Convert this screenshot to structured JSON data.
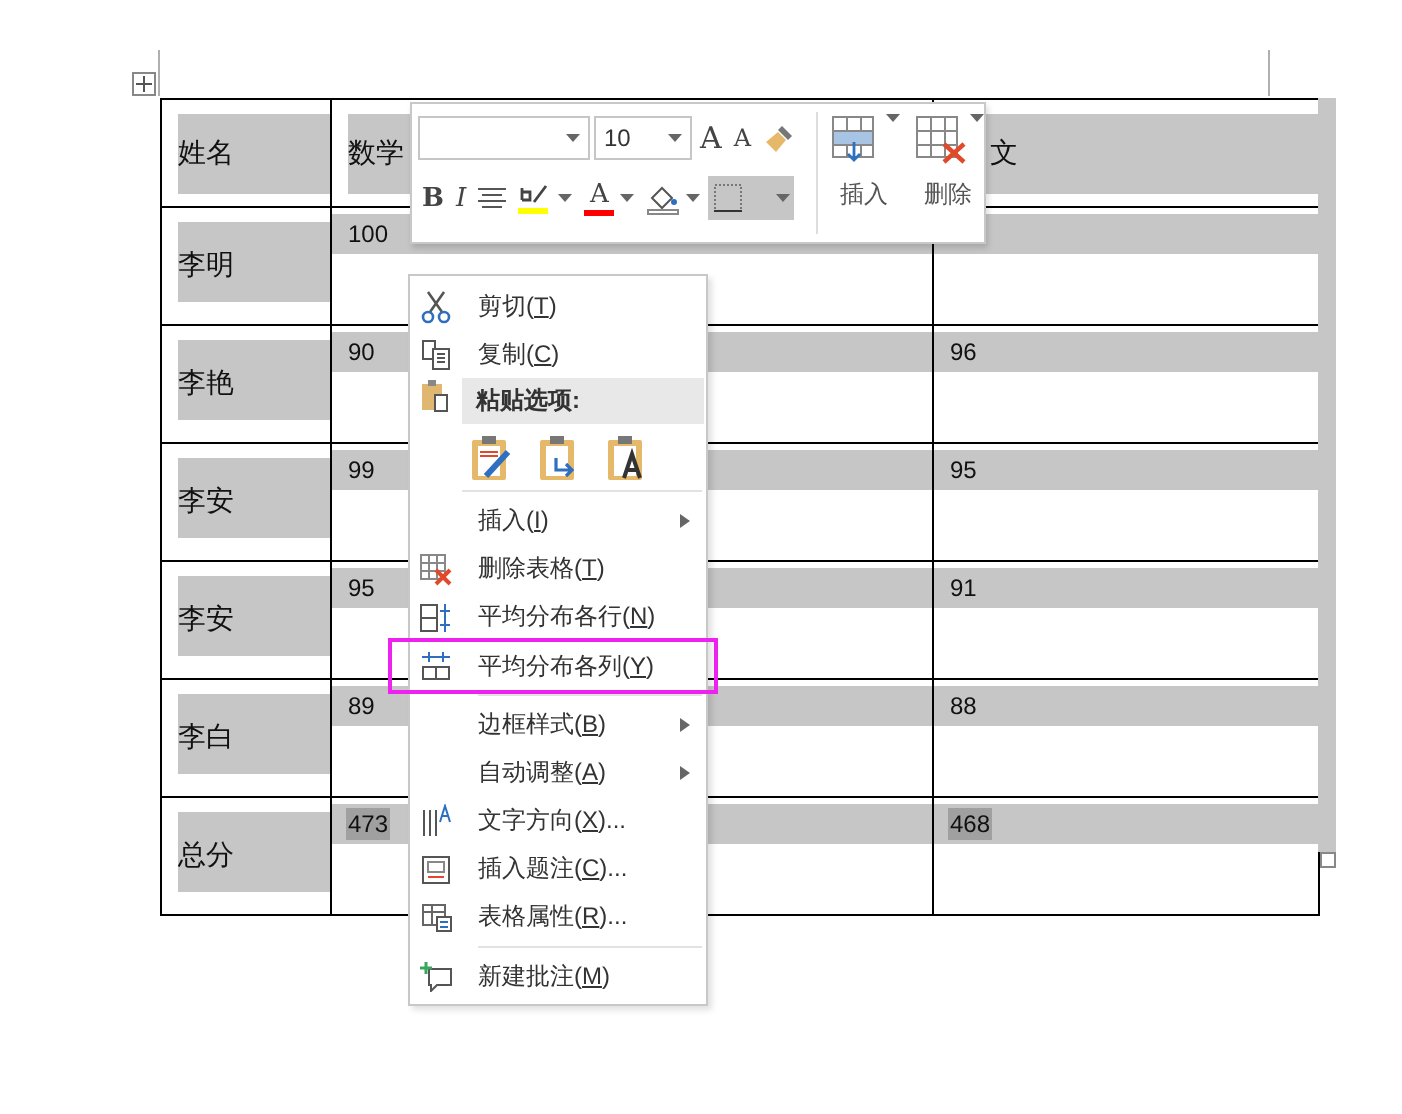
{
  "table": {
    "header": [
      "姓名",
      "数学",
      "文"
    ],
    "rows": [
      {
        "cells": [
          "李明",
          "100",
          ""
        ],
        "marked": false
      },
      {
        "cells": [
          "李艳",
          "90",
          "96"
        ],
        "marked": false
      },
      {
        "cells": [
          "李安",
          "99",
          "95"
        ],
        "marked": false
      },
      {
        "cells": [
          "李安",
          "95",
          "91"
        ],
        "marked": false
      },
      {
        "cells": [
          "李白",
          "89",
          "88"
        ],
        "marked": false
      },
      {
        "cells": [
          "总分",
          "473",
          "468"
        ],
        "marked": true
      }
    ]
  },
  "mini_toolbar": {
    "font_size": "10",
    "grow_font": "A",
    "shrink_font": "A",
    "bold": "B",
    "italic": "I",
    "font_color": "A",
    "borders_selected": true,
    "insert_label": "插入",
    "delete_label": "删除"
  },
  "context_menu": [
    {
      "kind": "item",
      "before": "剪切(",
      "key": "T",
      "after": ")",
      "submenu": false
    },
    {
      "kind": "item",
      "before": "复制(",
      "key": "C",
      "after": ")",
      "submenu": false
    },
    {
      "kind": "header",
      "text": "粘贴选项:"
    },
    {
      "kind": "paste_options"
    },
    {
      "kind": "separator"
    },
    {
      "kind": "item",
      "before": "插入(",
      "key": "I",
      "after": ")",
      "submenu": true
    },
    {
      "kind": "item",
      "before": "删除表格(",
      "key": "T",
      "after": ")",
      "submenu": false
    },
    {
      "kind": "item",
      "before": "平均分布各行(",
      "key": "N",
      "after": ")",
      "submenu": false
    },
    {
      "kind": "item",
      "before": "平均分布各列(",
      "key": "Y",
      "after": ")",
      "submenu": false,
      "framed": true
    },
    {
      "kind": "separator"
    },
    {
      "kind": "item",
      "before": "边框样式(",
      "key": "B",
      "after": ")",
      "submenu": true
    },
    {
      "kind": "item",
      "before": "自动调整(",
      "key": "A",
      "after": ")",
      "submenu": true
    },
    {
      "kind": "item",
      "before": "文字方向(",
      "key": "X",
      "after": ")...",
      "submenu": false
    },
    {
      "kind": "item",
      "before": "插入题注(",
      "key": "C",
      "after": ")...",
      "submenu": false
    },
    {
      "kind": "item",
      "before": "表格属性(",
      "key": "R",
      "after": ")...",
      "submenu": false
    },
    {
      "kind": "separator"
    },
    {
      "kind": "item",
      "before": "新建批注(",
      "key": "M",
      "after": ")",
      "submenu": false
    }
  ]
}
